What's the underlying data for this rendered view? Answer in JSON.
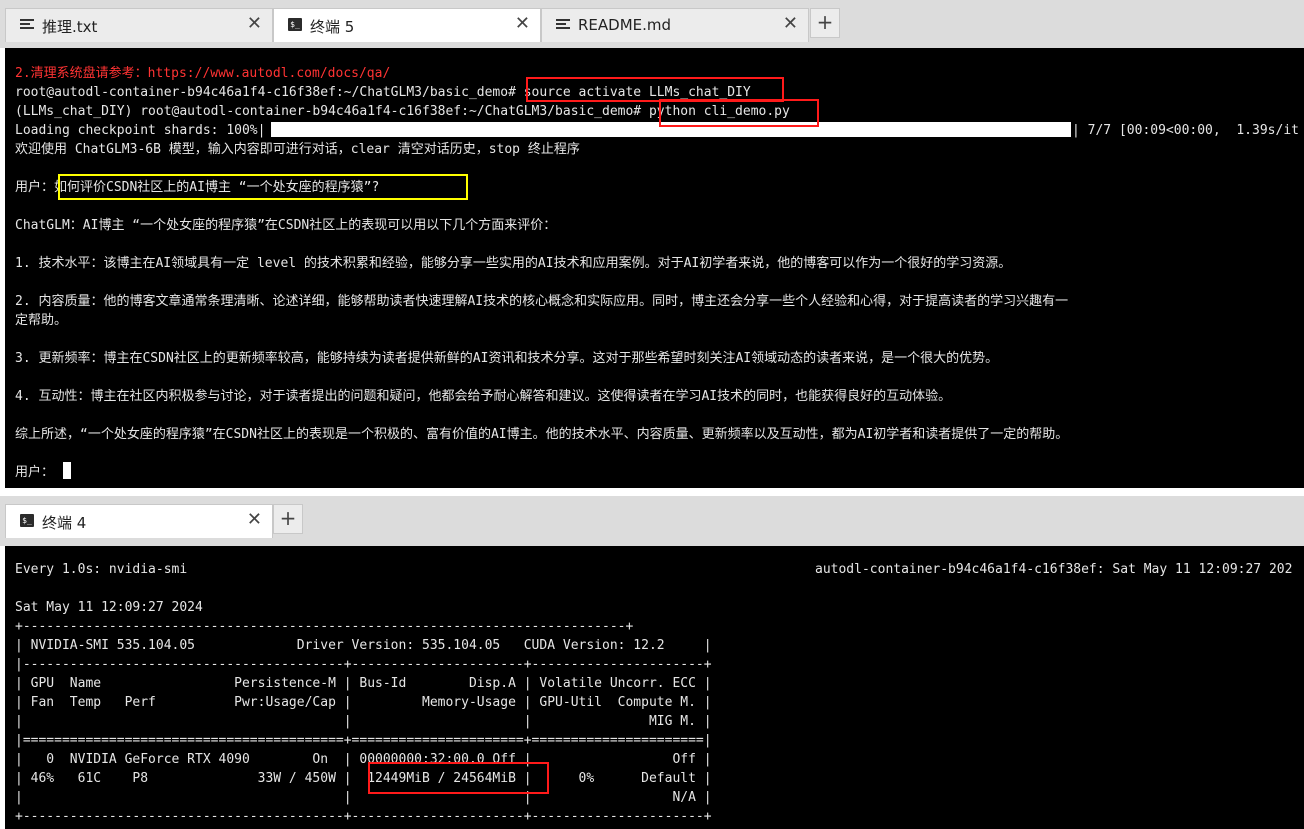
{
  "top_tabs": [
    {
      "label": "推理.txt",
      "icon": "document-icon",
      "active": false
    },
    {
      "label": "终端 5",
      "icon": "terminal-icon",
      "active": true
    },
    {
      "label": "README.md",
      "icon": "document-icon",
      "active": false
    }
  ],
  "bottom_tabs": [
    {
      "label": "终端 4",
      "icon": "terminal-icon",
      "active": true
    }
  ],
  "close_glyph": "✕",
  "add_glyph": "+",
  "colors": {
    "terminal_bg": "#000000",
    "terminal_fg": "#e6e6e6",
    "error_red": "#ff3333",
    "highlight_red": "#ff1a1a",
    "highlight_yellow": "#ffff00"
  },
  "terminal_top": {
    "lines": [
      "2.清理系统盘请参考：https://www.autodl.com/docs/qa/",
      "root@autodl-container-b94c46a1f4-c16f38ef:~/ChatGLM3/basic_demo# source activate LLMs_chat_DIY",
      "(LLMs_chat_DIY) root@autodl-container-b94c46a1f4-c16f38ef:~/ChatGLM3/basic_demo# python cli_demo.py",
      "Loading checkpoint shards: 100%|",
      "| 7/7 [00:09<00:00,  1.39s/it",
      "欢迎使用 ChatGLM3-6B 模型，输入内容即可进行对话，clear 清空对话历史，stop 终止程序",
      "用户：如何评价CSDN社区上的AI博主 “一个处女座的程序猿”?",
      "ChatGLM：AI博主 “一个处女座的程序猿”在CSDN社区上的表现可以用以下几个方面来评价：",
      "1. 技术水平：该博主在AI领域具有一定 level 的技术积累和经验，能够分享一些实用的AI技术和应用案例。对于AI初学者来说，他的博客可以作为一个很好的学习资源。",
      "2. 内容质量：他的博客文章通常条理清晰、论述详细，能够帮助读者快速理解AI技术的核心概念和实际应用。同时，博主还会分享一些个人经验和心得，对于提高读者的学习兴趣有一",
      "定帮助。",
      "3. 更新频率：博主在CSDN社区上的更新频率较高，能够持续为读者提供新鲜的AI资讯和技术分享。这对于那些希望时刻关注AI领域动态的读者来说，是一个很大的优势。",
      "4. 互动性：博主在社区内积极参与讨论，对于读者提出的问题和疑问，他都会给予耐心解答和建议。这使得读者在学习AI技术的同时，也能获得良好的互动体验。",
      "综上所述，“一个处女座的程序猿”在CSDN社区上的表现是一个积极的、富有价值的AI博主。他的技术水平、内容质量、更新频率以及互动性，都为AI初学者和读者提供了一定的帮助。",
      "用户："
    ],
    "progress_percent": 100
  },
  "terminal_bottom": {
    "lines": [
      "Every 1.0s: nvidia-smi",
      "autodl-container-b94c46a1f4-c16f38ef: Sat May 11 12:09:27 202",
      "Sat May 11 12:09:27 2024",
      "+-----------------------------------------------------------------------------+",
      "| NVIDIA-SMI 535.104.05             Driver Version: 535.104.05   CUDA Version: 12.2     |",
      "|-----------------------------------------+----------------------+----------------------+",
      "| GPU  Name                 Persistence-M | Bus-Id        Disp.A | Volatile Uncorr. ECC |",
      "| Fan  Temp   Perf          Pwr:Usage/Cap |         Memory-Usage | GPU-Util  Compute M. |",
      "|                                         |                      |               MIG M. |",
      "|=========================================+======================+======================|",
      "|   0  NVIDIA GeForce RTX 4090        On  | 00000000:32:00.0 Off |                  Off |",
      "| 46%   61C    P8              33W / 450W |  12449MiB / 24564MiB |      0%      Default |",
      "|                                         |                      |                  N/A |",
      "+-----------------------------------------+----------------------+----------------------+"
    ]
  }
}
